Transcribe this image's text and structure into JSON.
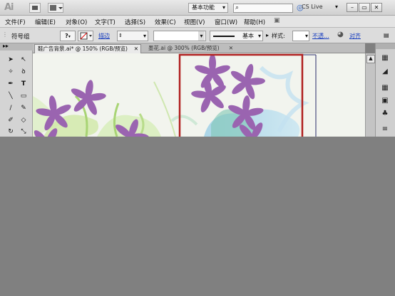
{
  "app": {
    "logo": "Ai",
    "workspace": "基本功能",
    "search_placeholder": "",
    "cs_live": "CS Live"
  },
  "menu": [
    "文件(F)",
    "编辑(E)",
    "对象(O)",
    "文字(T)",
    "选择(S)",
    "效果(C)",
    "视图(V)",
    "窗口(W)",
    "帮助(H)"
  ],
  "control": {
    "selection_label": "符号组",
    "stroke_link": "描边",
    "stroke_style": "基本",
    "style_label": "样式:",
    "opacity_link": "不透...",
    "align_link": "对齐"
  },
  "tabs": [
    {
      "label": "鞋广告背景.ai* @ 150% (RGB/预览)"
    },
    {
      "label": "墨花.ai @ 300% (RGB/预览)"
    }
  ],
  "colors": {
    "flower": "#9a64b0",
    "selection": "#b02020",
    "artboard_edge": "#2b2b6b"
  },
  "icons": [
    "selection-icon",
    "direct-selection-icon",
    "magic-wand-icon",
    "lasso-icon",
    "pen-icon",
    "type-icon",
    "line-icon",
    "rectangle-icon",
    "paintbrush-icon",
    "pencil-icon",
    "blob-brush-icon",
    "eraser-icon",
    "rotate-icon",
    "scale-icon"
  ]
}
